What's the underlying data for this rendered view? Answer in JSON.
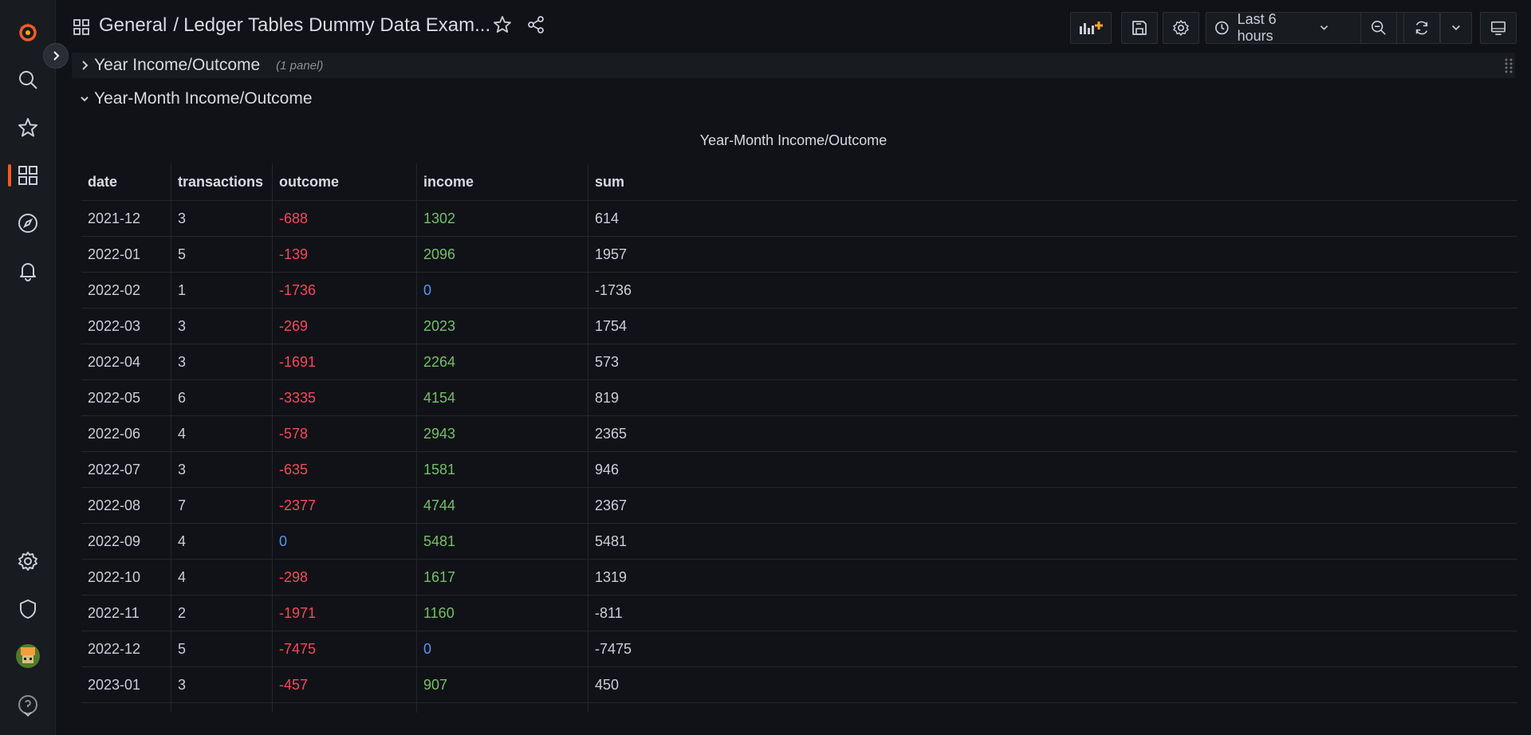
{
  "breadcrumb": {
    "folder": "General",
    "separator": "/",
    "dashboard": "Ledger Tables Dummy Data Exam..."
  },
  "toolbar": {
    "time_range": "Last 6 hours"
  },
  "rows": [
    {
      "title": "Year Income/Outcome",
      "count": "(1 panel)",
      "collapsed": true
    },
    {
      "title": "Year-Month Income/Outcome",
      "collapsed": false
    }
  ],
  "panel": {
    "title": "Year-Month Income/Outcome",
    "columns": [
      "date",
      "transactions",
      "outcome",
      "income",
      "sum"
    ],
    "rows": [
      [
        "2021-12",
        "3",
        "-688",
        "1302",
        "614"
      ],
      [
        "2022-01",
        "5",
        "-139",
        "2096",
        "1957"
      ],
      [
        "2022-02",
        "1",
        "-1736",
        "0",
        "-1736"
      ],
      [
        "2022-03",
        "3",
        "-269",
        "2023",
        "1754"
      ],
      [
        "2022-04",
        "3",
        "-1691",
        "2264",
        "573"
      ],
      [
        "2022-05",
        "6",
        "-3335",
        "4154",
        "819"
      ],
      [
        "2022-06",
        "4",
        "-578",
        "2943",
        "2365"
      ],
      [
        "2022-07",
        "3",
        "-635",
        "1581",
        "946"
      ],
      [
        "2022-08",
        "7",
        "-2377",
        "4744",
        "2367"
      ],
      [
        "2022-09",
        "4",
        "0",
        "5481",
        "5481"
      ],
      [
        "2022-10",
        "4",
        "-298",
        "1617",
        "1319"
      ],
      [
        "2022-11",
        "2",
        "-1971",
        "1160",
        "-811"
      ],
      [
        "2022-12",
        "5",
        "-7475",
        "0",
        "-7475"
      ],
      [
        "2023-01",
        "3",
        "-457",
        "907",
        "450"
      ]
    ]
  },
  "colors": {
    "negative": "#f2495c",
    "positive": "#73bf69",
    "zero": "#5794f2",
    "accent": "#f05a28"
  }
}
